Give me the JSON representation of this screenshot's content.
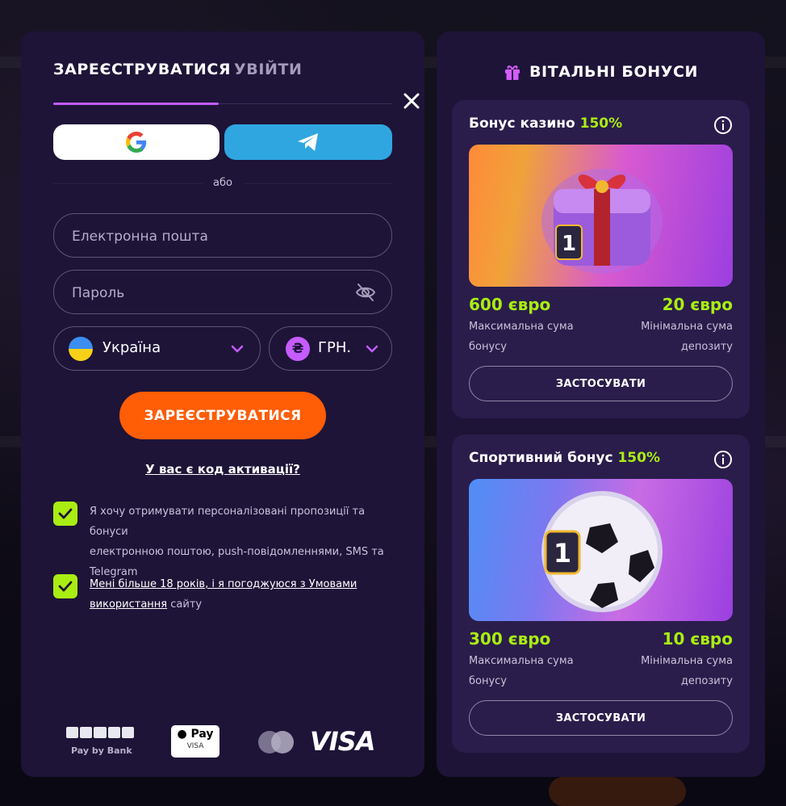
{
  "auth": {
    "tab_register": "ЗАРЕЄСТРУВАТИСЯ",
    "tab_login": "УВІЙТИ",
    "or_text": "або",
    "email_placeholder": "Електронна пошта",
    "password_placeholder": "Пароль",
    "country": "Україна",
    "currency_symbol": "₴",
    "currency": "ГРН.",
    "register_button": "ЗАРЕЄСТРУВАТИСЯ",
    "activation_code_link": "У вас є код активації?",
    "consent_marketing_line1": "Я хочу отримувати персоналізовані пропозиції та бонуси",
    "consent_marketing_line2": "електронною поштою, push-повідомленнями, SMS та",
    "consent_marketing_line3": "Telegram",
    "consent_terms_link_1": "Мені більше 18 років, і я погоджуюся з Умовами",
    "consent_terms_link_2": "використання",
    "consent_terms_tail": " сайту",
    "payments": {
      "pay_by_bank_label": "Pay by Bank",
      "apple_pay_label": "Pay",
      "apple_pay_sub": "VISA",
      "visa_label": "VISA"
    }
  },
  "bonuses": {
    "header": "ВІТАЛЬНІ БОНУСИ",
    "cards": [
      {
        "title": "Бонус казино",
        "percent": "150%",
        "image_icon": "gift-box-image",
        "max_amount": "600 євро",
        "max_label_1": "Максимальна сума",
        "max_label_2": "бонусу",
        "min_amount": "20 євро",
        "min_label_1": "Мінімальна сума",
        "min_label_2": "депозиту",
        "button": "ЗАСТОСУВАТИ"
      },
      {
        "title": "Спортивний бонус",
        "percent": "150%",
        "image_icon": "soccer-ball-image",
        "max_amount": "300 євро",
        "max_label_1": "Максимальна сума",
        "max_label_2": "бонусу",
        "min_amount": "10 євро",
        "min_label_1": "Мінімальна сума",
        "min_label_2": "депозиту",
        "button": "ЗАСТОСУВАТИ"
      }
    ]
  },
  "colors": {
    "panel": "#1e1438",
    "card": "#2a1d4b",
    "accent_green": "#a9ed13",
    "accent_orange": "#ff5d06",
    "accent_purple": "#c35cff",
    "telegram_blue": "#2fa6e0"
  }
}
